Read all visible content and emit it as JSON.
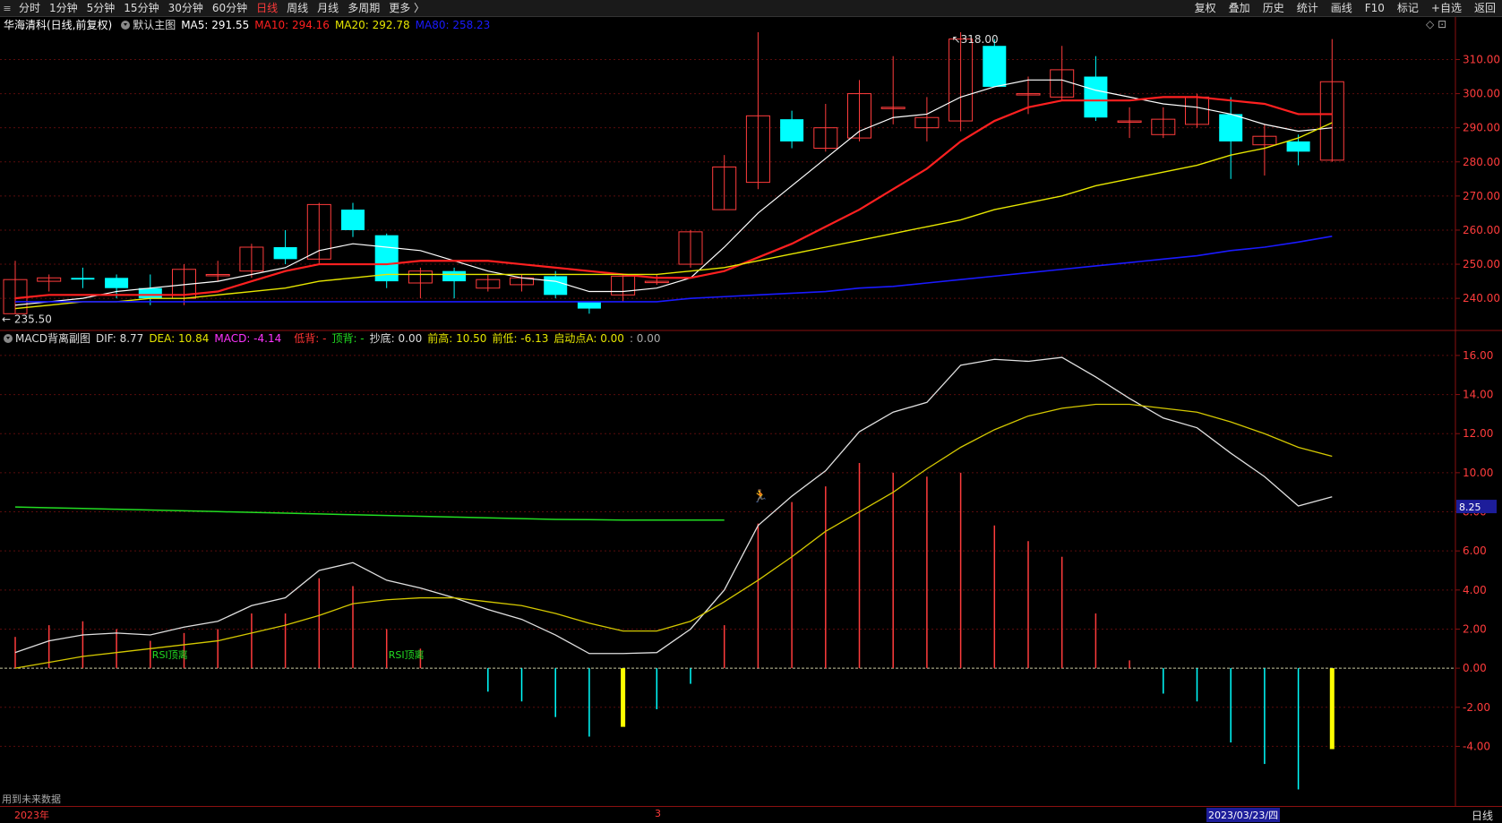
{
  "toolbar": {
    "periods": [
      "分时",
      "1分钟",
      "5分钟",
      "15分钟",
      "30分钟",
      "60分钟",
      "日线",
      "周线",
      "月线",
      "多周期",
      "更多 〉"
    ],
    "active_period": "日线",
    "right_buttons": [
      "复权",
      "叠加",
      "历史",
      "统计",
      "画线",
      "F10",
      "标记",
      "+自选",
      "返回"
    ]
  },
  "main_legend": {
    "title": "华海清科(日线,前复权)",
    "indicator": "默认主图",
    "ma5": "MA5: 291.55",
    "ma10": "MA10: 294.16",
    "ma20": "MA20: 292.78",
    "ma80": "MA80: 258.23",
    "high_label": "318.00",
    "low_label": "235.50",
    "icons": [
      "◇",
      "⊡"
    ]
  },
  "sub_legend": {
    "title": "MACD背离副图",
    "dif": "DIF: 8.77",
    "dea": "DEA: 10.84",
    "macd": "MACD: -4.14",
    "dibei": "低背: -",
    "dingbei": "顶背: -",
    "chaodi": "抄底: 0.00",
    "qiangao": "前高: 10.50",
    "qiandi": "前低: -6.13",
    "qidong": "启动点A: 0.00",
    "extra": ": 0.00",
    "rsi_label_1": "RSI顶离",
    "rsi_label_2": "RSI顶离",
    "dif_tag": "8.25"
  },
  "footer": {
    "note": "用到未来数据",
    "year": "2023年",
    "month": "3",
    "date": "2023/03/23/四",
    "period": "日线"
  },
  "colors": {
    "up": "#ff3c3c",
    "down": "#00ffff",
    "ma5": "#ffffff",
    "ma10": "#ff2020",
    "ma20": "#e6e600",
    "ma80": "#1a1aff",
    "dif": "#e0e0e0",
    "dea": "#d4c800",
    "green_line": "#22dd22"
  },
  "chart_data": [
    {
      "type": "candlestick",
      "title": "华海清科(日线,前复权)",
      "ylim": [
        234,
        318
      ],
      "yticks": [
        240,
        250,
        260,
        270,
        280,
        290,
        300,
        310
      ],
      "ytick_labels": [
        "240.00",
        "250.00",
        "260.00",
        "270.00",
        "280.00",
        "290.00",
        "300.00",
        "310.00"
      ],
      "candles": [
        {
          "o": 235.5,
          "c": 245.5,
          "h": 251,
          "l": 235.5
        },
        {
          "o": 245,
          "c": 246,
          "h": 247,
          "l": 242
        },
        {
          "o": 246,
          "c": 245.5,
          "h": 249,
          "l": 243
        },
        {
          "o": 246,
          "c": 243,
          "h": 247,
          "l": 240
        },
        {
          "o": 243,
          "c": 240,
          "h": 247,
          "l": 238
        },
        {
          "o": 240,
          "c": 248.5,
          "h": 250,
          "l": 238
        },
        {
          "o": 247,
          "c": 247,
          "h": 251,
          "l": 245
        },
        {
          "o": 248,
          "c": 255,
          "h": 256,
          "l": 246
        },
        {
          "o": 255,
          "c": 251.5,
          "h": 260,
          "l": 250
        },
        {
          "o": 251.5,
          "c": 267.5,
          "h": 268,
          "l": 250
        },
        {
          "o": 266,
          "c": 260,
          "h": 268,
          "l": 258
        },
        {
          "o": 258.5,
          "c": 245,
          "h": 259,
          "l": 243
        },
        {
          "o": 244.5,
          "c": 248,
          "h": 249,
          "l": 240
        },
        {
          "o": 248,
          "c": 245,
          "h": 249,
          "l": 240
        },
        {
          "o": 243,
          "c": 245.5,
          "h": 247,
          "l": 242
        },
        {
          "o": 244,
          "c": 246,
          "h": 247,
          "l": 242
        },
        {
          "o": 246.5,
          "c": 241,
          "h": 248,
          "l": 240
        },
        {
          "o": 239,
          "c": 237,
          "h": 239,
          "l": 235.5
        },
        {
          "o": 241,
          "c": 246.5,
          "h": 247,
          "l": 239
        },
        {
          "o": 245,
          "c": 245,
          "h": 247,
          "l": 244
        },
        {
          "o": 250,
          "c": 259.5,
          "h": 260,
          "l": 249
        },
        {
          "o": 266,
          "c": 278.5,
          "h": 282,
          "l": 266
        },
        {
          "o": 274,
          "c": 293.5,
          "h": 318,
          "l": 272
        },
        {
          "o": 292.5,
          "c": 286,
          "h": 295,
          "l": 284
        },
        {
          "o": 284,
          "c": 290,
          "h": 297,
          "l": 283
        },
        {
          "o": 287,
          "c": 300,
          "h": 304,
          "l": 286
        },
        {
          "o": 296,
          "c": 296,
          "h": 311,
          "l": 291
        },
        {
          "o": 290,
          "c": 293,
          "h": 299,
          "l": 286
        },
        {
          "o": 292,
          "c": 316,
          "h": 318,
          "l": 289
        },
        {
          "o": 314,
          "c": 302,
          "h": 316,
          "l": 302
        },
        {
          "o": 300,
          "c": 300,
          "h": 305,
          "l": 294
        },
        {
          "o": 299,
          "c": 307,
          "h": 314,
          "l": 298
        },
        {
          "o": 305,
          "c": 293,
          "h": 311,
          "l": 292
        },
        {
          "o": 292,
          "c": 292,
          "h": 296,
          "l": 287
        },
        {
          "o": 288,
          "c": 292.5,
          "h": 296,
          "l": 287
        },
        {
          "o": 291,
          "c": 299,
          "h": 300,
          "l": 290
        },
        {
          "o": 294,
          "c": 286,
          "h": 299,
          "l": 275
        },
        {
          "o": 285,
          "c": 287.5,
          "h": 291,
          "l": 276
        },
        {
          "o": 286,
          "c": 283,
          "h": 288,
          "l": 279
        },
        {
          "o": 280.5,
          "c": 303.5,
          "h": 316,
          "l": 280
        }
      ],
      "series": [
        {
          "name": "MA5",
          "values": [
            238,
            239,
            240,
            242,
            243,
            244,
            245,
            247,
            249,
            254,
            256,
            255,
            254,
            251,
            248,
            246,
            245,
            242,
            242,
            243,
            246,
            255,
            265,
            273,
            281,
            289,
            293,
            294,
            299,
            302,
            304,
            304,
            301,
            299,
            297,
            296,
            294,
            291,
            289,
            290
          ]
        },
        {
          "name": "MA10",
          "values": [
            240,
            241,
            241,
            241,
            241,
            241,
            242,
            245,
            248,
            250,
            250,
            250,
            251,
            251,
            251,
            250,
            249,
            248,
            247,
            246,
            246,
            248,
            252,
            256,
            261,
            266,
            272,
            278,
            286,
            292,
            296,
            298,
            298,
            298,
            299,
            299,
            298,
            297,
            294,
            294
          ]
        },
        {
          "name": "MA20",
          "values": [
            237,
            238,
            239,
            239,
            240,
            240,
            241,
            242,
            243,
            245,
            246,
            247,
            247,
            247,
            247,
            247,
            247,
            247,
            247,
            247,
            248,
            249,
            251,
            253,
            255,
            257,
            259,
            261,
            263,
            266,
            268,
            270,
            273,
            275,
            277,
            279,
            282,
            284,
            287,
            291.5
          ]
        },
        {
          "name": "MA80",
          "values": [
            239,
            239,
            239,
            239,
            239,
            239,
            239,
            239,
            239,
            239,
            239,
            239,
            239,
            239,
            239,
            239,
            239,
            239,
            239,
            239,
            240,
            240.5,
            241,
            241.5,
            242,
            243,
            243.5,
            244.5,
            245.5,
            246.5,
            247.5,
            248.5,
            249.5,
            250.5,
            251.5,
            252.5,
            254,
            255,
            256.5,
            258.2
          ]
        }
      ]
    },
    {
      "type": "line",
      "title": "MACD背离副图",
      "ylim": [
        -6.5,
        16.5
      ],
      "yticks": [
        -4,
        -2,
        0,
        2,
        4,
        6,
        8,
        10,
        12,
        14,
        16
      ],
      "ytick_labels": [
        "-4.00",
        "-2.00",
        "0.00",
        "2.00",
        "4.00",
        "6.00",
        "8.00",
        "10.00",
        "12.00",
        "14.00",
        "16.00"
      ],
      "series": [
        {
          "name": "DIF",
          "values": [
            0.8,
            1.4,
            1.7,
            1.8,
            1.7,
            2.1,
            2.4,
            3.2,
            3.6,
            5.0,
            5.4,
            4.5,
            4.1,
            3.6,
            3.0,
            2.5,
            1.7,
            0.75,
            0.75,
            0.8,
            2.0,
            4.0,
            7.3,
            8.8,
            10.1,
            12.1,
            13.1,
            13.6,
            15.5,
            15.8,
            15.7,
            15.9,
            14.9,
            13.8,
            12.8,
            12.3,
            11.0,
            9.8,
            8.3,
            8.77
          ]
        },
        {
          "name": "DEA",
          "values": [
            0,
            0.3,
            0.6,
            0.8,
            1.0,
            1.2,
            1.4,
            1.8,
            2.2,
            2.7,
            3.3,
            3.5,
            3.6,
            3.6,
            3.4,
            3.2,
            2.8,
            2.3,
            1.9,
            1.9,
            2.4,
            3.4,
            4.5,
            5.7,
            7.0,
            8.0,
            9.0,
            10.2,
            11.3,
            12.2,
            12.9,
            13.3,
            13.5,
            13.5,
            13.3,
            13.1,
            12.6,
            12.0,
            11.3,
            10.84
          ]
        },
        {
          "name": "MACD",
          "values": [
            1.6,
            2.2,
            2.4,
            2.0,
            1.4,
            1.8,
            2.0,
            2.8,
            2.8,
            4.6,
            4.2,
            2.0,
            1.0,
            0,
            -1.2,
            -1.7,
            -2.5,
            -3.5,
            -2.9,
            -2.1,
            -0.8,
            2.2,
            7.4,
            8.5,
            9.3,
            10.5,
            10.0,
            9.8,
            10.0,
            7.3,
            6.5,
            5.7,
            2.8,
            0.4,
            -1.3,
            -1.7,
            -3.8,
            -4.9,
            -6.2,
            -4.14
          ]
        },
        {
          "name": "green",
          "values": [
            8.25,
            8.21,
            8.17,
            8.13,
            8.09,
            8.05,
            8.01,
            7.97,
            7.93,
            7.89,
            7.85,
            7.81,
            7.77,
            7.73,
            7.69,
            7.65,
            7.61,
            7.6,
            7.58,
            7.58,
            7.58,
            7.58
          ]
        }
      ],
      "signals": [
        {
          "index": 18,
          "value": -3.0
        },
        {
          "index": 39,
          "value": -4.14
        }
      ]
    }
  ]
}
